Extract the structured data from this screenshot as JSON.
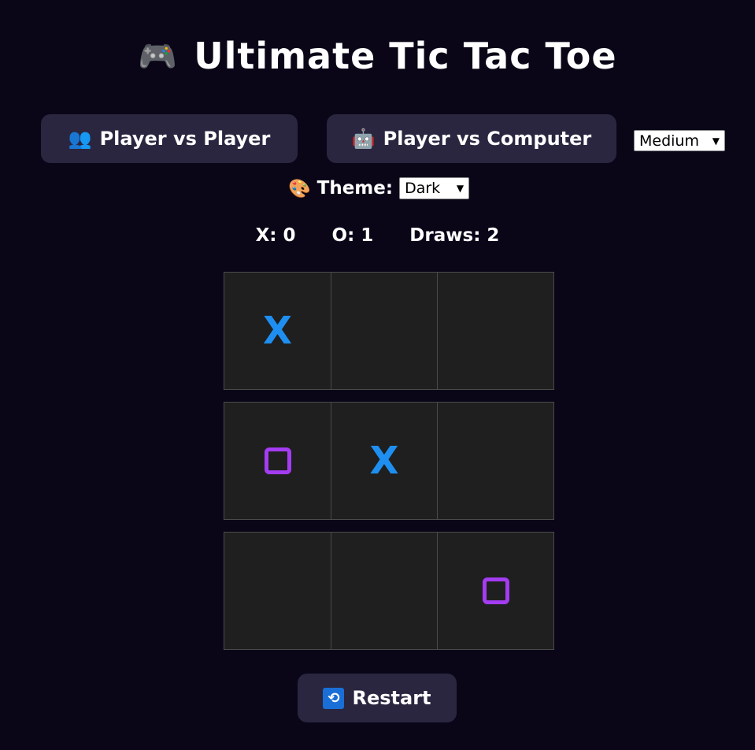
{
  "header": {
    "icon": "game-controller-icon",
    "icon_glyph": "🎮",
    "title": "Ultimate Tic Tac Toe"
  },
  "modes": {
    "pvp": {
      "icon": "two-players-icon",
      "icon_glyph": "👥",
      "label": "Player vs Player"
    },
    "pvc": {
      "icon": "robot-icon",
      "icon_glyph": "🤖",
      "label": "Player vs Computer"
    }
  },
  "difficulty": {
    "selected": "Medium"
  },
  "theme": {
    "icon": "palette-icon",
    "icon_glyph": "🎨",
    "label": "Theme:",
    "selected": "Dark"
  },
  "score": {
    "x": "X: 0",
    "o": "O: 1",
    "draws": "Draws: 2"
  },
  "board": {
    "cells": [
      "X",
      "",
      "",
      "O",
      "X",
      "",
      "",
      "",
      "O"
    ]
  },
  "restart": {
    "icon": "restart-icon",
    "icon_glyph": "🔁",
    "label": "Restart"
  },
  "colors": {
    "background": "#0a0618",
    "button": "#2a2640",
    "cell": "#1f1f1f",
    "x_mark": "#1e8ff0",
    "o_mark": "#a43cf2"
  }
}
